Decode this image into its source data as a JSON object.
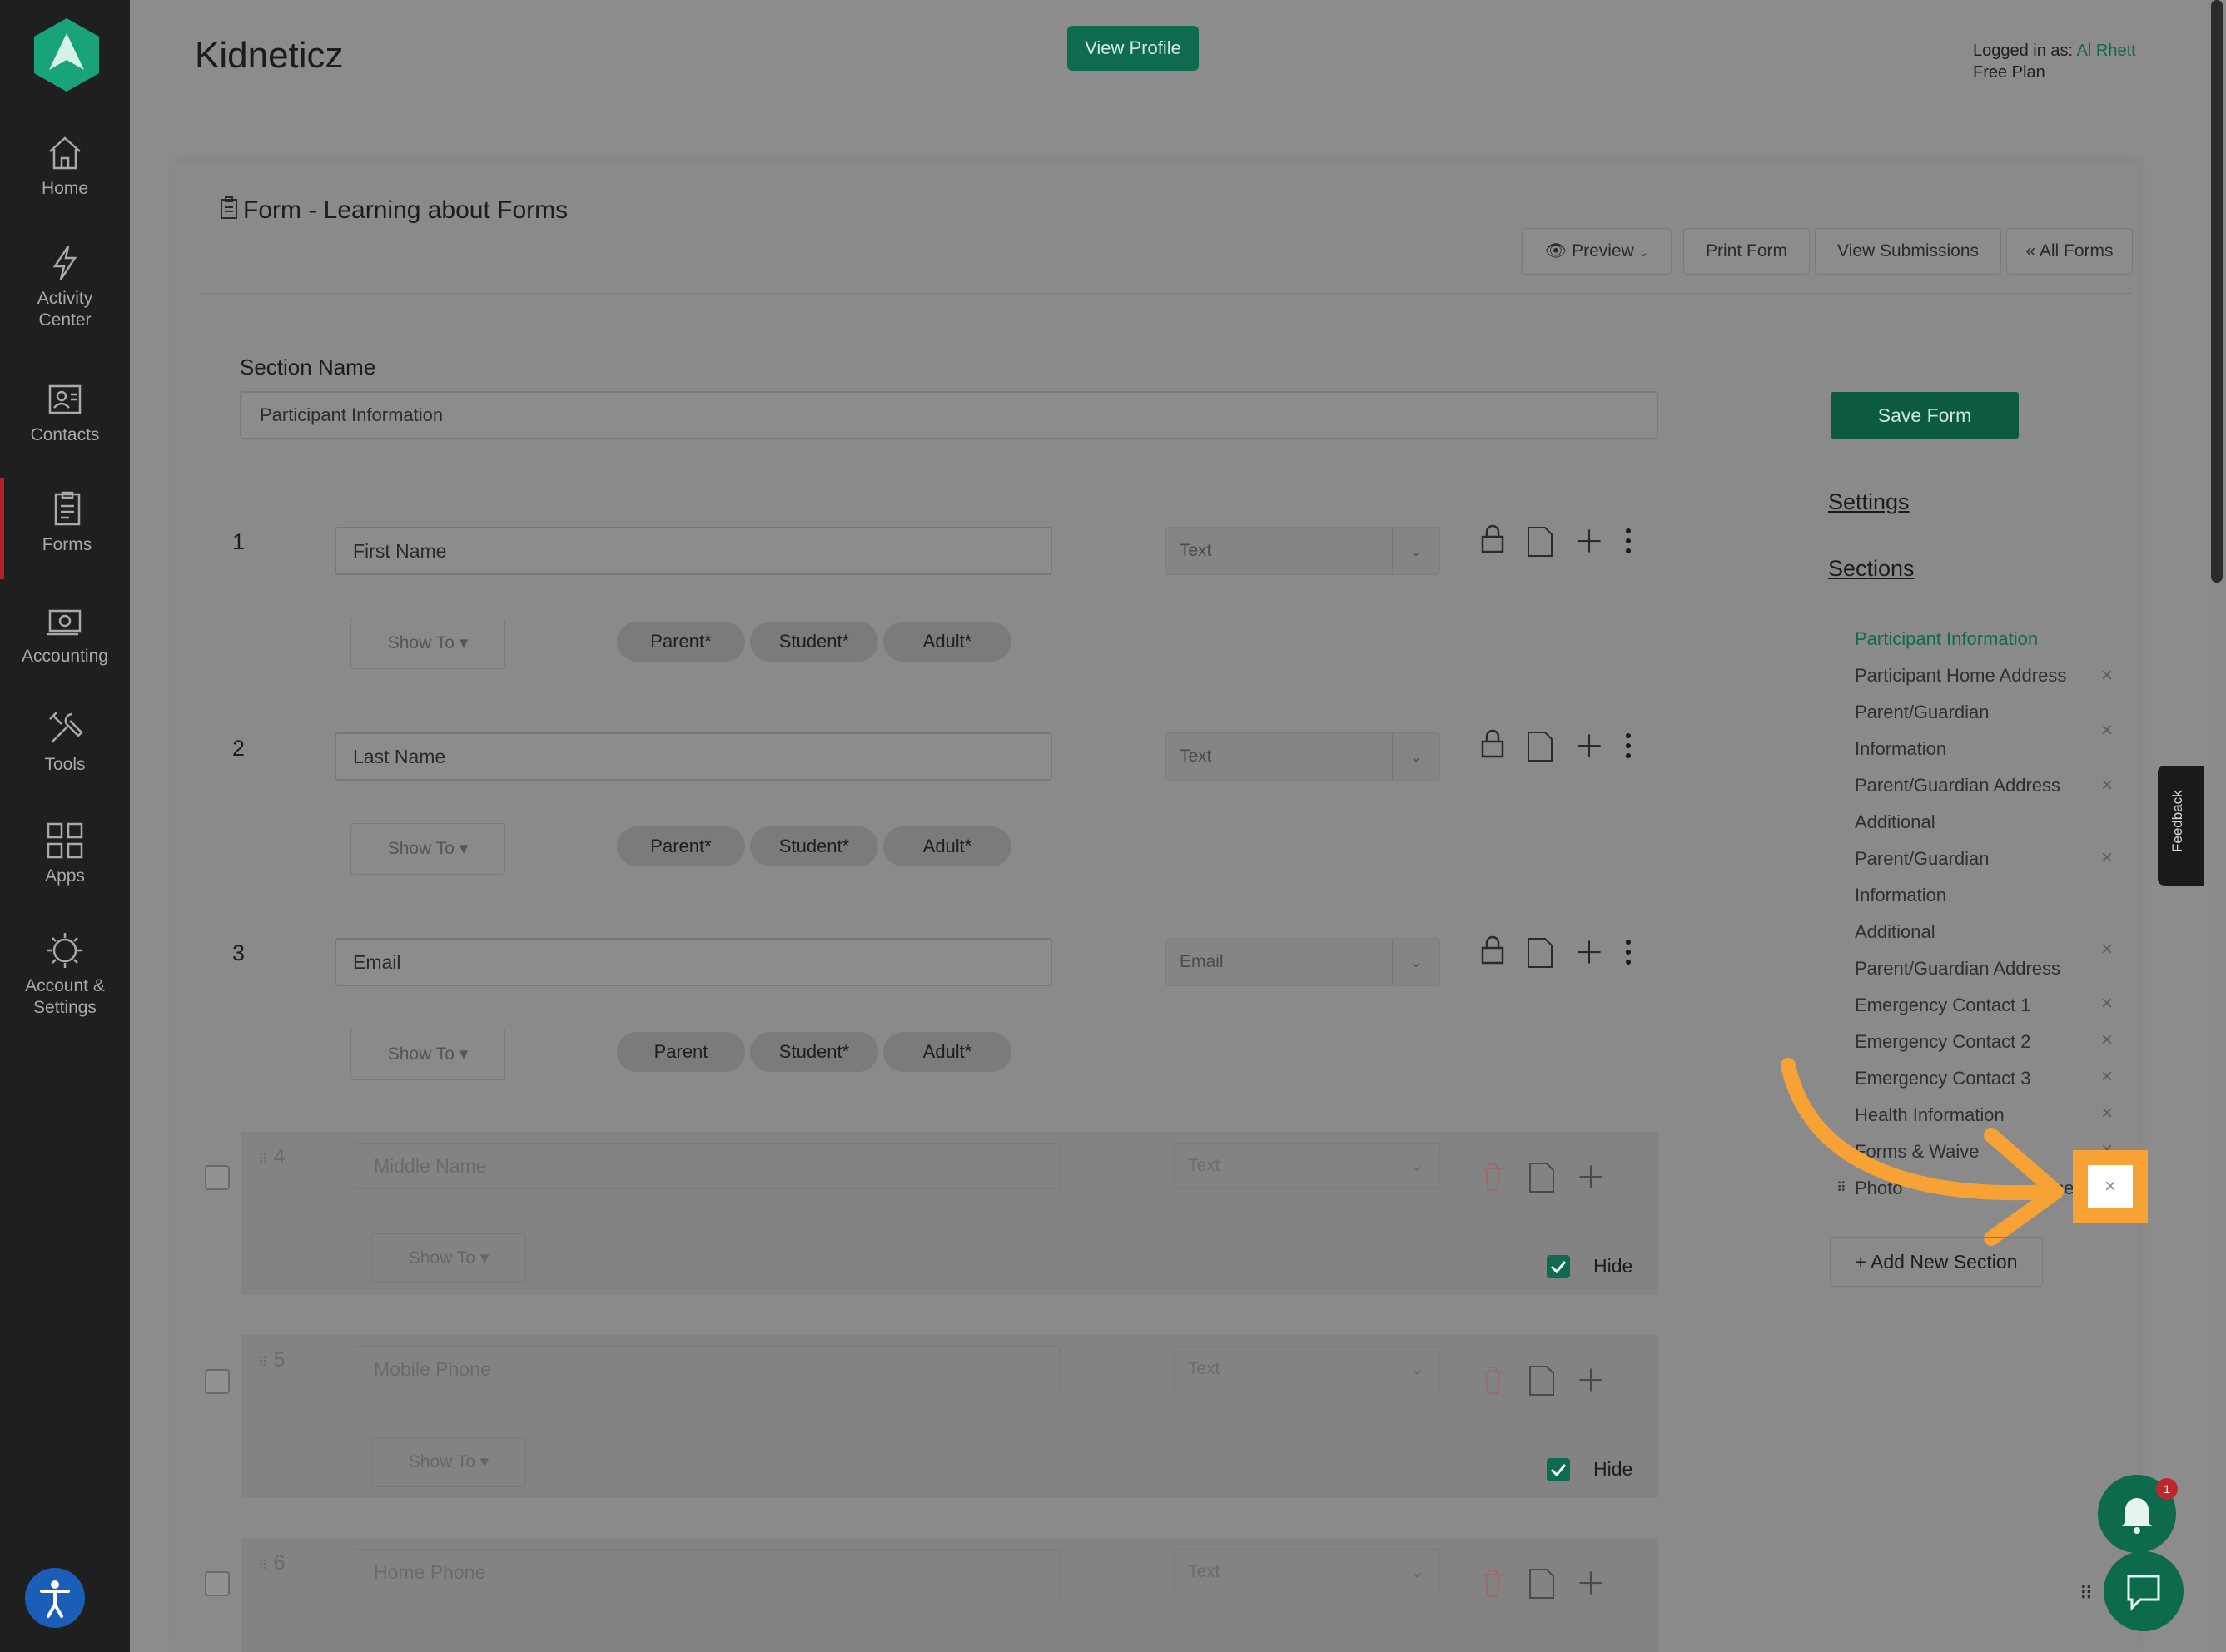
{
  "app": {
    "brand": "Kidneticz",
    "view_profile_label": "View Profile",
    "logged_in_prefix": "Logged in as: ",
    "user_name": "Al Rhett",
    "plan": "Free Plan"
  },
  "sidebar": {
    "items": [
      {
        "label": "Home",
        "icon": "home-icon"
      },
      {
        "label": "Activity Center",
        "icon": "lightning-icon"
      },
      {
        "label": "Contacts",
        "icon": "contacts-icon"
      },
      {
        "label": "Forms",
        "icon": "forms-icon"
      },
      {
        "label": "Accounting",
        "icon": "cash-icon"
      },
      {
        "label": "Tools",
        "icon": "tools-icon"
      },
      {
        "label": "Apps",
        "icon": "apps-grid-icon"
      },
      {
        "label": "Account & Settings",
        "icon": "gear-icon"
      }
    ]
  },
  "form": {
    "title": "Form - Learning about Forms",
    "preview_label": "Preview",
    "print_label": "Print Form",
    "submissions_label": "View Submissions",
    "all_forms_label": "« All Forms",
    "section_name_label": "Section Name",
    "section_name_value": "Participant Information",
    "save_label": "Save Form"
  },
  "fields": [
    {
      "num": "1",
      "name": "First Name",
      "type": "Text",
      "show_to": "Show To",
      "pills": [
        "Parent*",
        "Student*",
        "Adult*"
      ]
    },
    {
      "num": "2",
      "name": "Last Name",
      "type": "Text",
      "show_to": "Show To",
      "pills": [
        "Parent*",
        "Student*",
        "Adult*"
      ]
    },
    {
      "num": "3",
      "name": "Email",
      "type": "Email",
      "show_to": "Show To",
      "pills": [
        "Parent",
        "Student*",
        "Adult*"
      ]
    }
  ],
  "hidden_fields": [
    {
      "num": "4",
      "name": "Middle Name",
      "type": "Text",
      "show_to": "Show To",
      "hide_label": "Hide"
    },
    {
      "num": "5",
      "name": "Mobile Phone",
      "type": "Text",
      "show_to": "Show To",
      "hide_label": "Hide"
    },
    {
      "num": "6",
      "name": "Home Phone",
      "type": "Text"
    }
  ],
  "right_panel": {
    "settings_label": "Settings",
    "sections_label": "Sections",
    "sections": [
      "Participant Information",
      "Participant Home Address",
      "Parent/Guardian",
      "Information",
      "Parent/Guardian Address",
      "Additional",
      "Parent/Guardian",
      "Information",
      "Additional",
      "Parent/Guardian Address",
      "Emergency Contact 1",
      "Emergency Contact 2",
      "Emergency Contact 3",
      "Health Information",
      "Forms & Waive",
      "Photo",
      "ase"
    ],
    "add_section_label": "+ Add New Section",
    "close_glyph": "×"
  },
  "feedback_label": "Feedback",
  "notification_count": "1",
  "colors": {
    "accent": "#0e6b4f",
    "highlight": "#f7a234",
    "badge": "#c0272d"
  }
}
